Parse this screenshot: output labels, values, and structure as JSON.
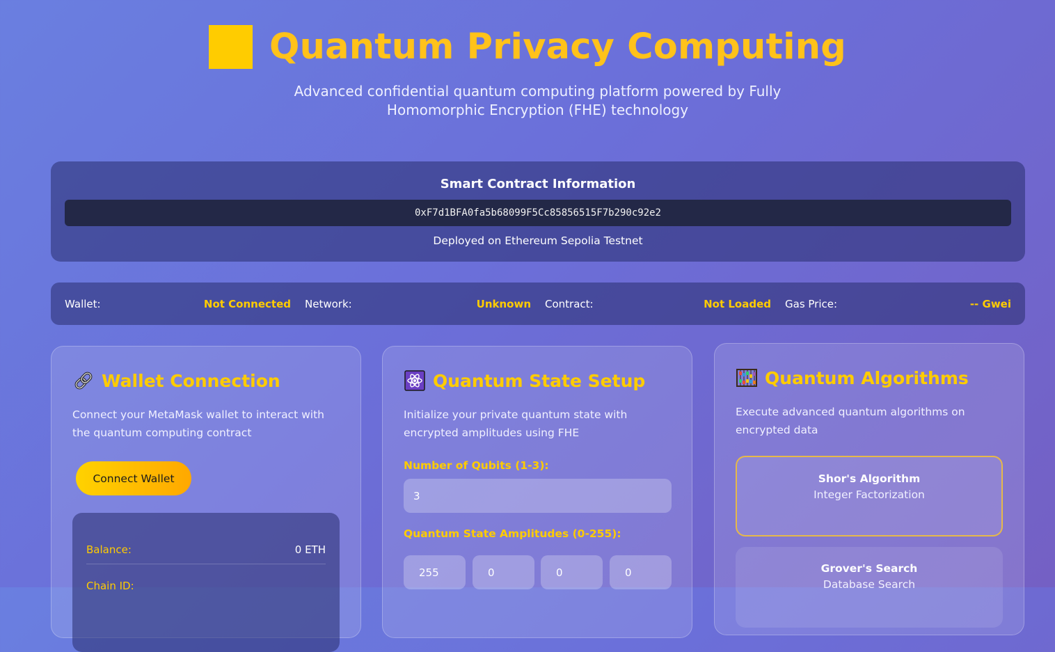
{
  "header": {
    "title": "Quantum Privacy Computing",
    "subtitle": "Advanced confidential quantum computing platform powered by Fully Homomorphic Encryption (FHE) technology",
    "accent_color": "#ffcc00"
  },
  "contract": {
    "title": "Smart Contract Information",
    "address": "0xF7d1BFA0fa5b68099F5Cc85856515F7b290c92e2",
    "network_note": "Deployed on Ethereum Sepolia Testnet"
  },
  "status_bar": {
    "items": [
      {
        "label": "Wallet:",
        "value": "Not Connected"
      },
      {
        "label": "Network:",
        "value": "Unknown"
      },
      {
        "label": "Contract:",
        "value": "Not Loaded"
      },
      {
        "label": "Gas Price:",
        "value": "-- Gwei"
      }
    ]
  },
  "wallet_card": {
    "icon": "link-icon",
    "title": "Wallet Connection",
    "description": "Connect your MetaMask wallet to interact with the quantum computing contract",
    "connect_label": "Connect Wallet",
    "info": [
      {
        "label": "Balance:",
        "value": "0 ETH"
      },
      {
        "label": "Chain ID:",
        "value": ""
      }
    ]
  },
  "state_card": {
    "icon": "atom-icon",
    "title": "Quantum State Setup",
    "description": "Initialize your private quantum state with encrypted amplitudes using FHE",
    "qubits_label": "Number of Qubits (1-3):",
    "qubits_value": "3",
    "amplitudes_label": "Quantum State Amplitudes (0-255):",
    "amplitudes": [
      "255",
      "0",
      "0",
      "0"
    ]
  },
  "algorithms_card": {
    "icon": "abacus-icon",
    "title": "Quantum Algorithms",
    "description": "Execute advanced quantum algorithms on encrypted data",
    "algorithms": [
      {
        "name": "Shor's Algorithm",
        "desc": "Integer Factorization",
        "selected": true
      },
      {
        "name": "Grover's Search",
        "desc": "Database Search",
        "selected": false
      }
    ]
  }
}
